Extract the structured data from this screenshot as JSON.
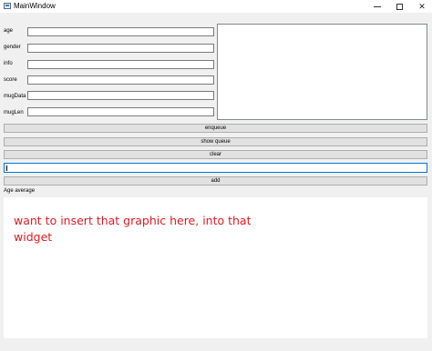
{
  "window": {
    "title": "MainWindow",
    "minimize_symbol": "",
    "maximize_symbol": "",
    "close_symbol": "✕"
  },
  "form": {
    "fields": [
      {
        "label": "age",
        "value": ""
      },
      {
        "label": "gender",
        "value": ""
      },
      {
        "label": "info",
        "value": ""
      },
      {
        "label": "score",
        "value": ""
      },
      {
        "label": "mugData",
        "value": ""
      },
      {
        "label": "mugLen",
        "value": ""
      }
    ]
  },
  "buttons": {
    "enqueue": "enqueue",
    "show_queue": "show queue",
    "clear": "clear",
    "add": "add"
  },
  "input": {
    "value": ""
  },
  "age_average": {
    "label": "Age average"
  },
  "annotation": {
    "text": "want to insert that graphic here, into that widget"
  },
  "colors": {
    "annotation": "#e01b22",
    "focus_border": "#0078d7"
  }
}
